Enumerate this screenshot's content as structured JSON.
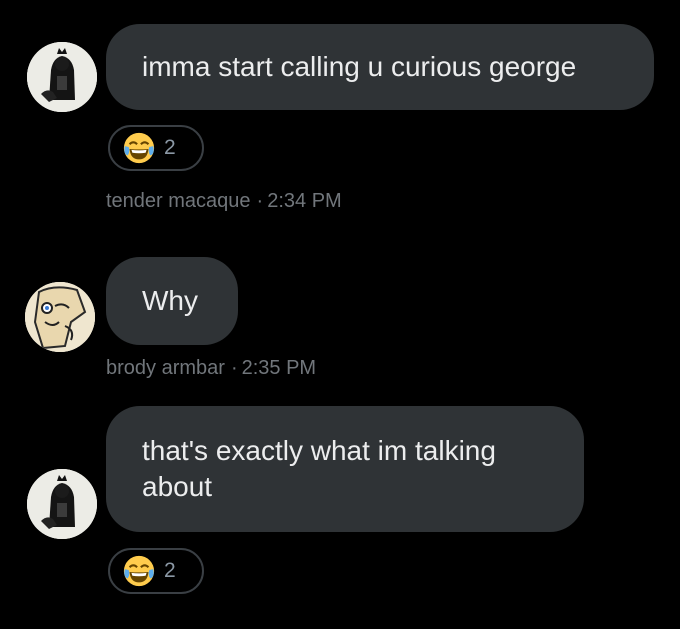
{
  "messages": [
    {
      "sender": "tender macaque",
      "time": "2:34 PM",
      "text": "imma start calling u curious george",
      "reaction": {
        "icon": "face-with-tears-of-joy-icon",
        "count": "2"
      }
    },
    {
      "sender": "brody armbar",
      "time": "2:35 PM",
      "text": "Why"
    },
    {
      "text": "that's exactly what im talking\nabout",
      "reaction": {
        "icon": "face-with-tears-of-joy-icon",
        "count": "2"
      }
    }
  ],
  "meta_separator": "·",
  "colors": {
    "background": "#000000",
    "bubble": "#2f3336",
    "text": "#ecedee",
    "meta": "#71767b",
    "reaction_border": "#3a3f44"
  }
}
